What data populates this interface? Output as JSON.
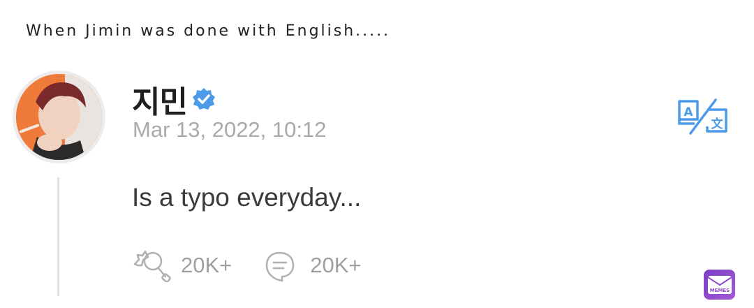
{
  "caption": "When Jimin was done with English.....",
  "post": {
    "author": "지민",
    "timestamp": "Mar 13, 2022, 10:12",
    "text": "Is a typo everyday...",
    "likes_count": "20K+",
    "comments_count": "20K+"
  },
  "icons": {
    "verified": "verified-badge-icon",
    "translate": "translate-icon",
    "like": "lollipop-like-icon",
    "comment": "comment-bubble-icon",
    "watermark": "memes-logo-icon"
  },
  "colors": {
    "accent": "#4b9bea",
    "muted_text": "#a9a9ae",
    "avatar_bg": "#f07a3a",
    "watermark": "#8e4ccf"
  },
  "watermark_text": "MEMES"
}
